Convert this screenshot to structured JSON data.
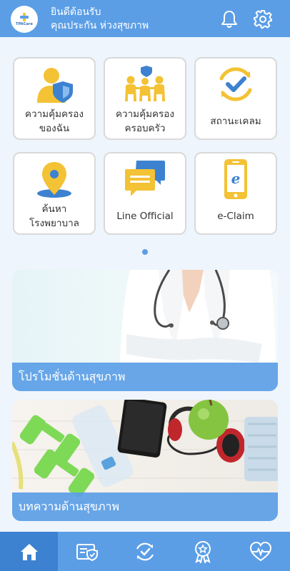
{
  "header": {
    "logo_text": "TPACare",
    "greeting_line1": "ยินดีต้อนรับ",
    "greeting_line2": "คุณประกัน ห่วงสุขภาพ"
  },
  "menu": [
    {
      "id": "my-coverage",
      "line1": "ความคุ้มครอง",
      "line2": "ของฉัน",
      "icon": "person-shield-icon"
    },
    {
      "id": "family-coverage",
      "line1": "ความคุ้มครอง",
      "line2": "ครอบครัว",
      "icon": "family-shield-icon"
    },
    {
      "id": "claim-status",
      "line1": "สถานะเคลม",
      "line2": "",
      "icon": "check-refresh-icon"
    },
    {
      "id": "find-hospital",
      "line1": "ค้นหา",
      "line2": "โรงพยาบาล",
      "icon": "map-pin-icon"
    },
    {
      "id": "line-official",
      "line1": "Line Official",
      "line2": "",
      "icon": "chat-bubbles-icon"
    },
    {
      "id": "e-claim",
      "line1": "e-Claim",
      "line2": "",
      "icon": "smartphone-e-icon"
    }
  ],
  "banners": {
    "promo_caption": "โปรโมชั่นด้านสุขภาพ",
    "article_caption": "บทความด้านสุขภาพ"
  },
  "bottom_nav": [
    "home-icon",
    "policy-card-icon",
    "check-refresh-icon",
    "award-ribbon-icon",
    "heart-pulse-icon"
  ],
  "colors": {
    "primary": "#5b9ee6",
    "active_nav": "#3d82d0",
    "icon_yellow": "#f3c235",
    "icon_blue": "#3d82d0"
  }
}
